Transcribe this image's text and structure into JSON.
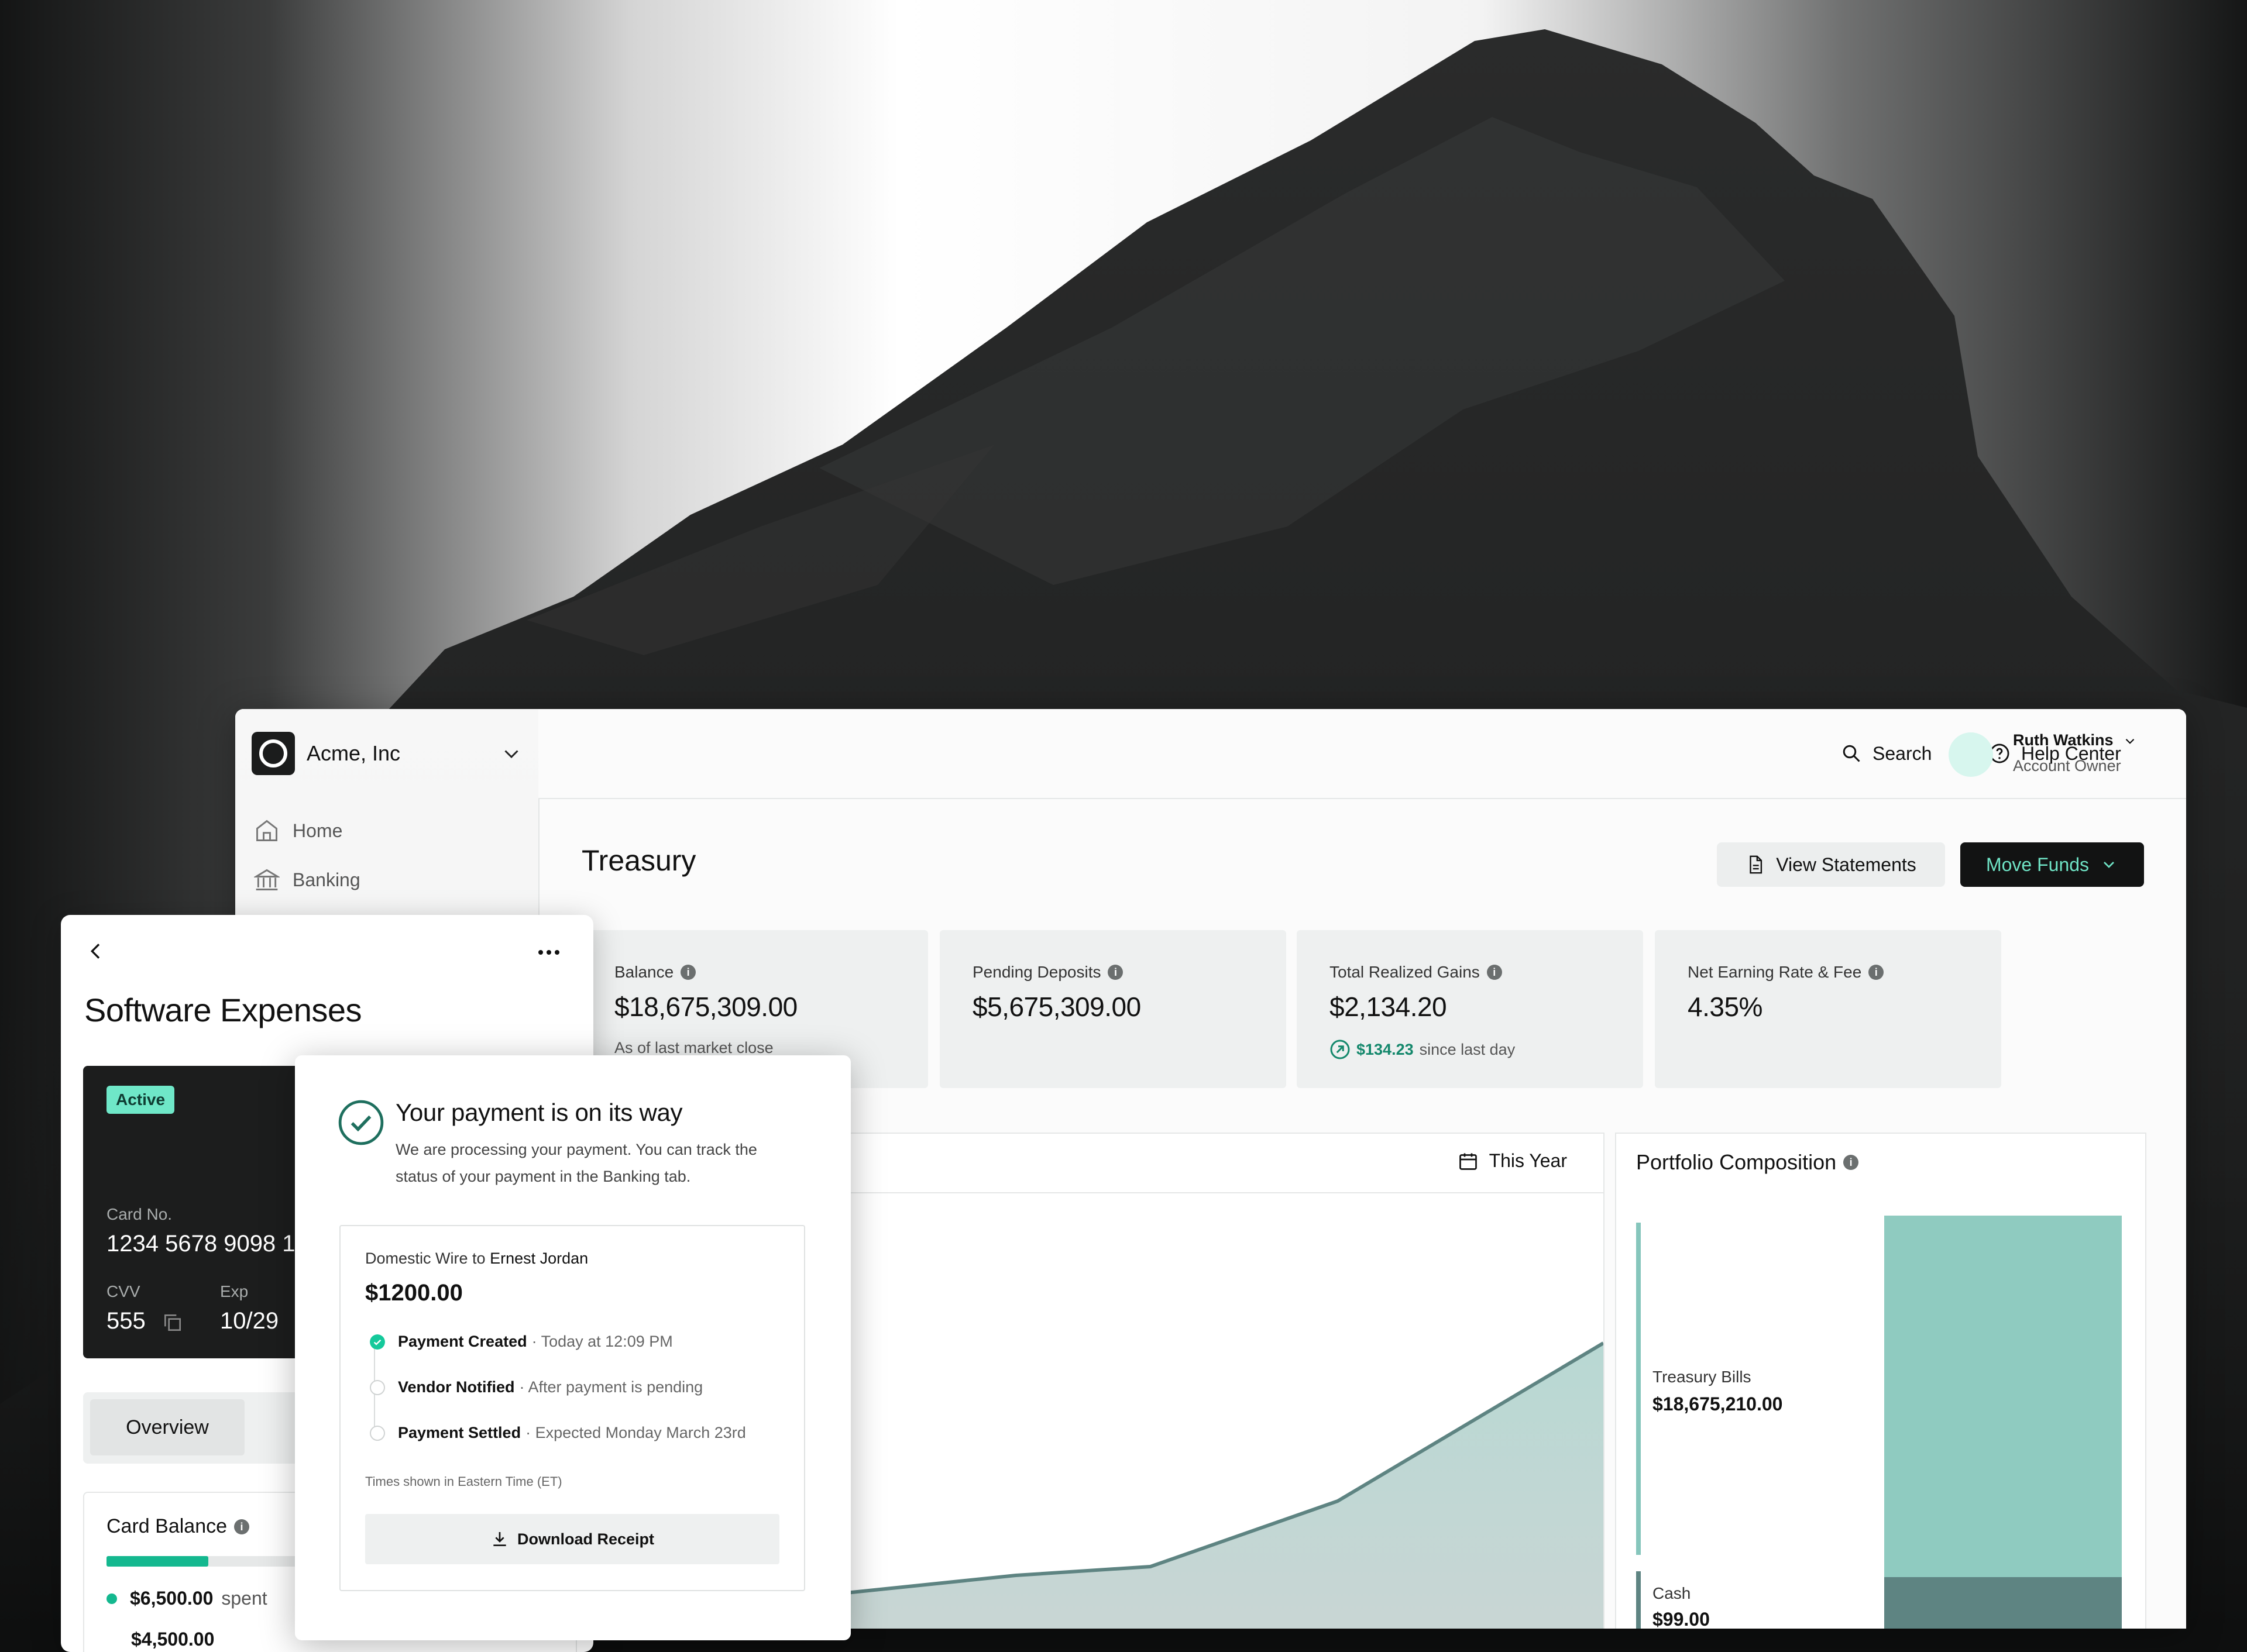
{
  "colors": {
    "accent": "#6fe3c5",
    "dark": "#121313",
    "chart_fill": "#b6d6d2",
    "chart_line": "#5e8482",
    "success": "#14b88f"
  },
  "org": {
    "name": "Acme, Inc"
  },
  "sidebar": {
    "items": [
      {
        "label": "Home",
        "icon": "home-icon"
      },
      {
        "label": "Banking",
        "icon": "bank-icon"
      }
    ]
  },
  "topbar": {
    "search": "Search",
    "help": "Help Center",
    "user_name": "Ruth Watkins",
    "user_role": "Account Owner"
  },
  "page": {
    "title": "Treasury",
    "view_statements": "View Statements",
    "move_funds": "Move Funds"
  },
  "stats": [
    {
      "label": "Balance",
      "value": "$18,675,309.00",
      "sub": "As of last market close"
    },
    {
      "label": "Pending Deposits",
      "value": "$5,675,309.00"
    },
    {
      "label": "Total Realized Gains",
      "value": "$2,134.20",
      "delta": "$134.23",
      "delta_text": "since last day"
    },
    {
      "label": "Net Earning Rate & Fee",
      "value": "4.35%"
    }
  ],
  "chart": {
    "range": "This Year"
  },
  "portfolio": {
    "title": "Portfolio Composition",
    "items": [
      {
        "name": "Treasury Bills",
        "value": "$18,675,210.00"
      },
      {
        "name": "Cash",
        "value": "$99.00"
      }
    ]
  },
  "expenses": {
    "title": "Software Expenses",
    "status": "Active",
    "card_no_label": "Card No.",
    "card_no": "1234 5678 9098 1",
    "cvv_label": "CVV",
    "cvv": "555",
    "exp_label": "Exp",
    "exp": "10/29",
    "tab": "Overview",
    "balance_title": "Card Balance",
    "spent_value": "$6,500.00",
    "spent_text": "spent",
    "next_value": "$4,500.00"
  },
  "payment": {
    "title": "Your payment is on its way",
    "desc": "We are processing your payment. You can track the status of your payment in the Banking tab.",
    "wire_prefix": "Domestic Wire to",
    "recipient": "Ernest Jordan",
    "amount": "$1200.00",
    "steps": [
      {
        "name": "Payment Created",
        "detail": "· Today at 12:09 PM",
        "done": true
      },
      {
        "name": "Vendor Notified",
        "detail": "· After payment is pending",
        "done": false
      },
      {
        "name": "Payment Settled",
        "detail": "· Expected Monday March 23rd",
        "done": false
      }
    ],
    "timezone_note": "Times shown in Eastern Time (ET)",
    "download": "Download Receipt"
  }
}
